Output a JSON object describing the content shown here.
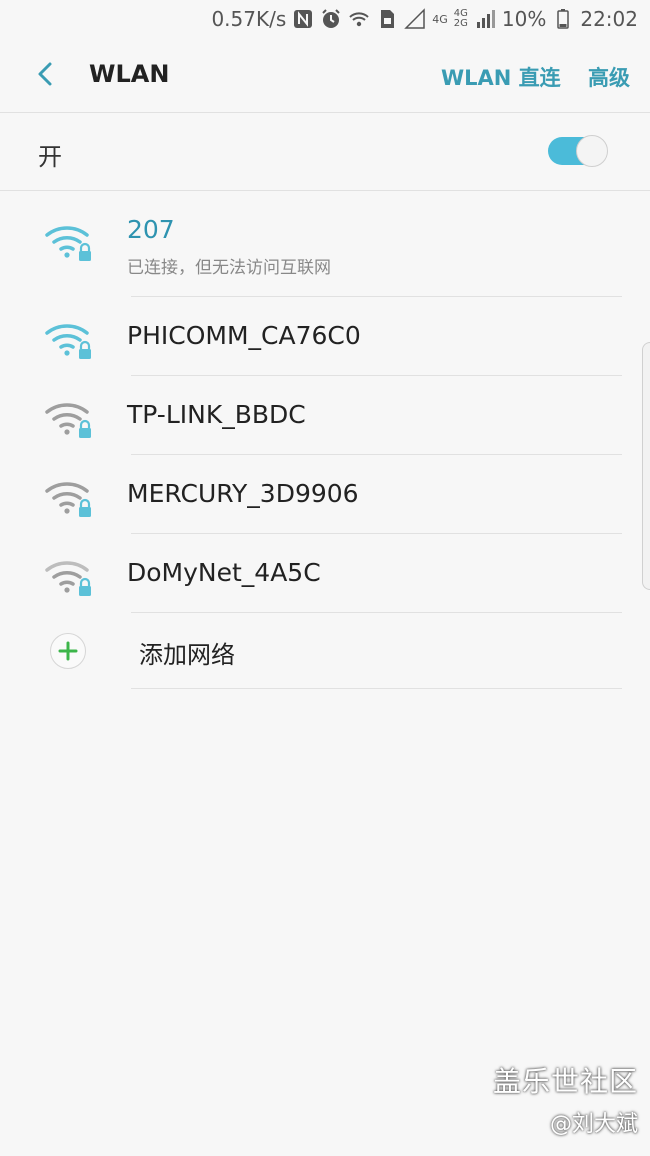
{
  "status_bar": {
    "speed": "0.57K/s",
    "network_4g": "4G",
    "network_4g_top": "4G",
    "network_2g": "2G",
    "battery": "10%",
    "time": "22:02",
    "icons": [
      "nfc-icon",
      "alarm-icon",
      "wifi-status-icon",
      "sim-icon",
      "signal-empty-icon",
      "signal-icon",
      "battery-icon"
    ]
  },
  "app_bar": {
    "title": "WLAN",
    "direct_label": "WLAN 直连",
    "advanced_label": "高级"
  },
  "toggle": {
    "label": "开",
    "state": "on",
    "color": "#4bbbd9"
  },
  "networks": [
    {
      "name": "207",
      "status": "已连接，但无法访问互联网",
      "connected": true,
      "signal": "strong",
      "color": "#5cc1d8"
    },
    {
      "name": "PHICOMM_CA76C0",
      "signal": "strong",
      "color": "#5cc1d8"
    },
    {
      "name": "TP-LINK_BBDC",
      "signal": "medium",
      "color": "#9e9e9e"
    },
    {
      "name": "MERCURY_3D9906",
      "signal": "medium",
      "color": "#9e9e9e"
    },
    {
      "name": "DoMyNet_4A5C",
      "signal": "weak",
      "color": "#9e9e9e"
    }
  ],
  "add_network": {
    "label": "添加网络"
  },
  "watermark": {
    "title": "盖乐世社区",
    "author": "@刘大斌"
  },
  "colors": {
    "accent": "#3a9cb3",
    "connected_name": "#2e93b0",
    "wifi_active": "#5cc1d8",
    "wifi_inactive": "#9e9e9e",
    "add_green": "#3cb54a"
  }
}
